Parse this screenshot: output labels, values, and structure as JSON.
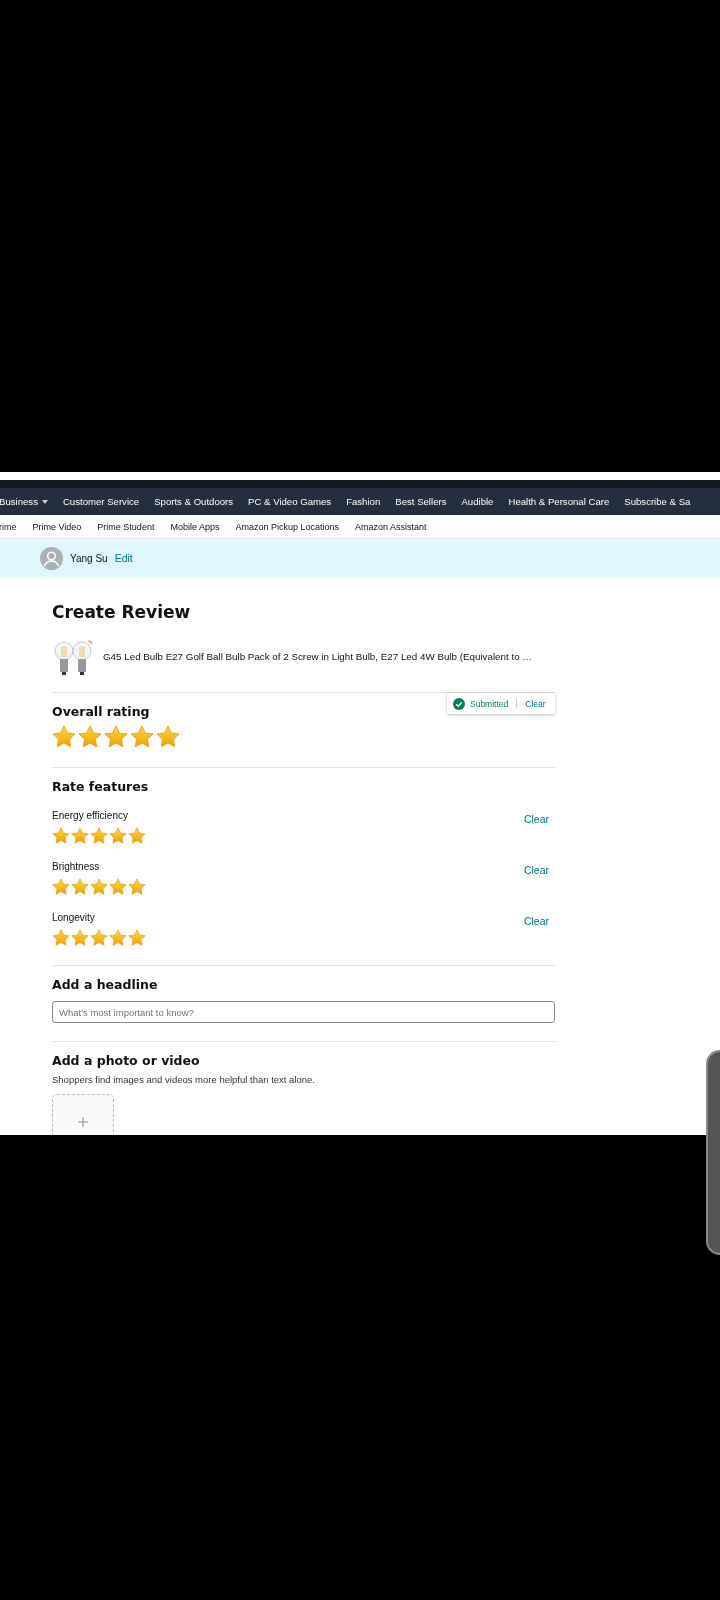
{
  "nav": {
    "primary": [
      {
        "label": "Business",
        "dropdown": true
      },
      {
        "label": "Customer Service",
        "dropdown": false
      },
      {
        "label": "Sports & Outdoors",
        "dropdown": false
      },
      {
        "label": "PC & Video Games",
        "dropdown": false
      },
      {
        "label": "Fashion",
        "dropdown": false
      },
      {
        "label": "Best Sellers",
        "dropdown": false
      },
      {
        "label": "Audible",
        "dropdown": false
      },
      {
        "label": "Health & Personal Care",
        "dropdown": false
      },
      {
        "label": "Subscribe & Sa",
        "dropdown": false
      }
    ],
    "secondary": [
      "rime",
      "Prime Video",
      "Prime Student",
      "Mobile Apps",
      "Amazon Pickup Locations",
      "Amazon Assistant"
    ]
  },
  "user": {
    "name": "Yang Su",
    "edit": "Edit"
  },
  "review": {
    "title": "Create Review",
    "product": "G45 Led Bulb E27 Golf Ball Bulb Pack of 2 Screw in Light Bulb, E27 Led 4W Bulb (Equivalent to …",
    "overall": {
      "label": "Overall rating",
      "stars": 5,
      "status": "Submitted",
      "clear": "Clear"
    },
    "features_title": "Rate features",
    "features": [
      {
        "label": "Energy efficiency",
        "stars": 5,
        "clear": "Clear"
      },
      {
        "label": "Brightness",
        "stars": 5,
        "clear": "Clear"
      },
      {
        "label": "Longevity",
        "stars": 5,
        "clear": "Clear"
      }
    ],
    "headline": {
      "label": "Add a headline",
      "placeholder": "What's most important to know?"
    },
    "media": {
      "label": "Add a photo or video",
      "hint": "Shoppers find images and videos more helpful than text alone."
    }
  }
}
